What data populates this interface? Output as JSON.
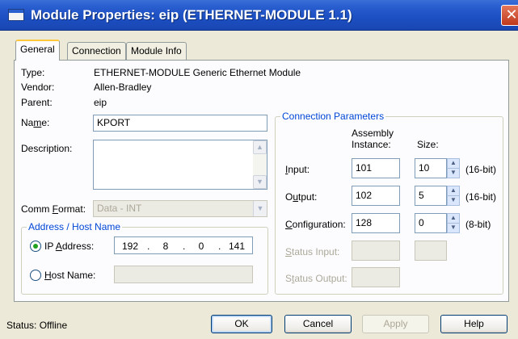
{
  "window": {
    "title": "Module Properties: eip (ETHERNET-MODULE 1.1)",
    "close_glyph": "✕"
  },
  "tabs": [
    "General",
    "Connection",
    "Module Info"
  ],
  "general": {
    "type_label": "Type:",
    "type_value": "ETHERNET-MODULE Generic Ethernet Module",
    "vendor_label": "Vendor:",
    "vendor_value": "Allen-Bradley",
    "parent_label": "Parent:",
    "parent_value": "eip",
    "name_label_pre": "Na",
    "name_label_u": "m",
    "name_label_post": "e:",
    "name_value": "KPORT",
    "description_label": "Description:",
    "description_value": "",
    "comm_format_label_pre": "Comm ",
    "comm_format_label_u": "F",
    "comm_format_label_post": "ormat:",
    "comm_format_value": "Data - INT"
  },
  "address": {
    "group_title": "Address / Host Name",
    "ip_label_pre": "IP ",
    "ip_label_u": "A",
    "ip_label_post": "ddress:",
    "ip_octets": [
      "192",
      "8",
      "0",
      "141"
    ],
    "ip_selected": true,
    "host_label_pre": "",
    "host_label_u": "H",
    "host_label_post": "ost Name:",
    "host_value": ""
  },
  "connection_params": {
    "group_title": "Connection Parameters",
    "col_instance_line1": "Assembly",
    "col_instance_line2": "Instance:",
    "col_size": "Size:",
    "rows": [
      {
        "label_pre": "",
        "label_u": "I",
        "label_post": "nput:",
        "instance": "101",
        "size": "10",
        "unit": "(16-bit)",
        "enabled": true
      },
      {
        "label_pre": "O",
        "label_u": "u",
        "label_post": "tput:",
        "instance": "102",
        "size": "5",
        "unit": "(16-bit)",
        "enabled": true
      },
      {
        "label_pre": "",
        "label_u": "C",
        "label_post": "onfiguration:",
        "instance": "128",
        "size": "0",
        "unit": "(8-bit)",
        "enabled": true
      },
      {
        "label_pre": "",
        "label_u": "S",
        "label_post": "tatus Input:",
        "instance": "",
        "size": "",
        "unit": "",
        "enabled": false
      },
      {
        "label_pre": "S",
        "label_u": "t",
        "label_post": "atus Output:",
        "instance": "",
        "size": "",
        "unit": "",
        "enabled": false
      }
    ]
  },
  "footer": {
    "status_text": "Status:  Offline",
    "ok": "OK",
    "cancel": "Cancel",
    "apply": "Apply",
    "help": "Help"
  },
  "colors": {
    "title_bar": "#1c4fc2",
    "group_title": "#0046d5",
    "tab_highlight": "#ffc83c",
    "radio_dot": "#21a121"
  }
}
